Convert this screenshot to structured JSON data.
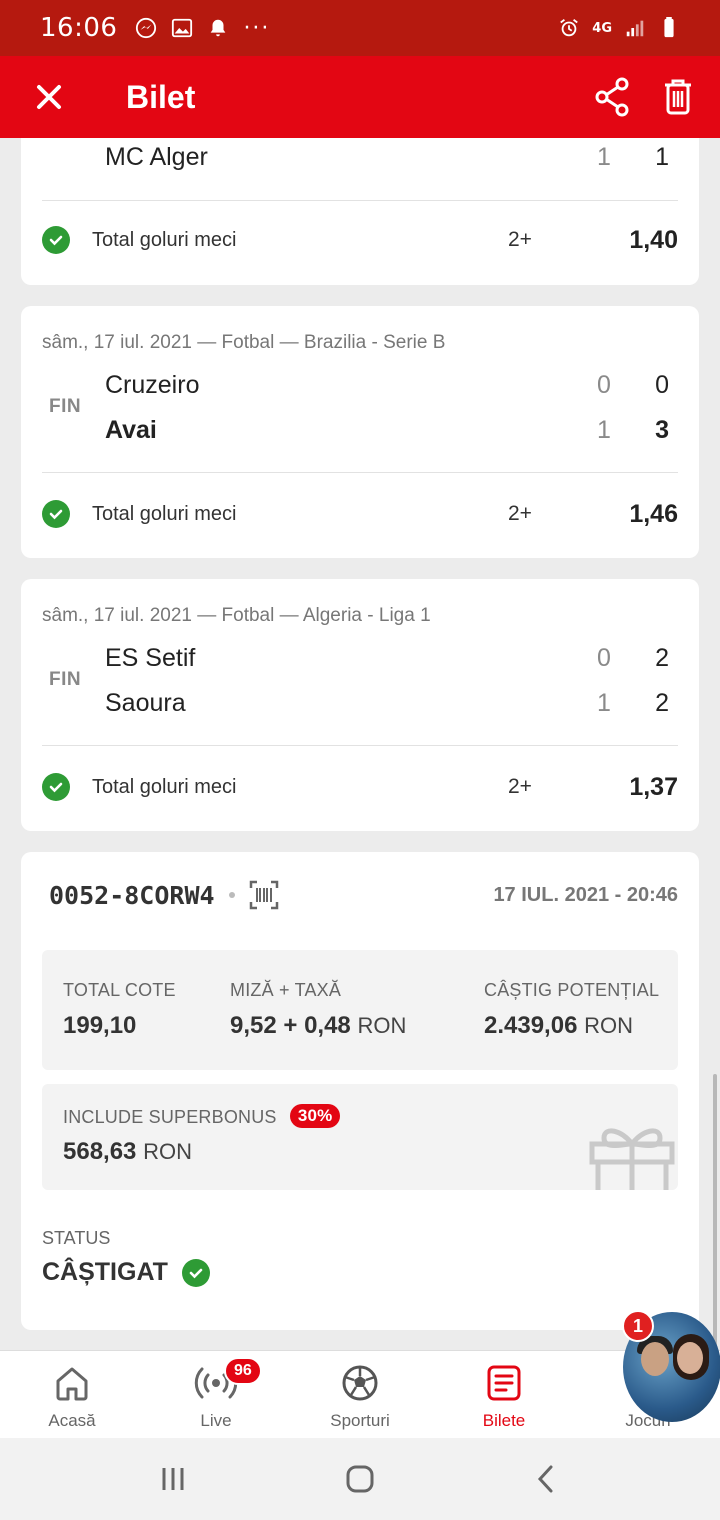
{
  "status_bar": {
    "time": "16:06",
    "network": "4G"
  },
  "app_bar": {
    "title": "Bilet"
  },
  "matches": [
    {
      "meta": "",
      "state": "",
      "teams": [
        {
          "name": "MC Alger",
          "ht": "1",
          "ft": "1",
          "winner": false
        }
      ],
      "market": "Total goluri meci",
      "selection": "2+",
      "odd": "1,40",
      "result": "won"
    },
    {
      "meta": "sâm., 17 iul. 2021 — Fotbal — Brazilia - Serie B",
      "state": "FIN",
      "teams": [
        {
          "name": "Cruzeiro",
          "ht": "0",
          "ft": "0",
          "winner": false
        },
        {
          "name": "Avai",
          "ht": "1",
          "ft": "3",
          "winner": true
        }
      ],
      "market": "Total goluri meci",
      "selection": "2+",
      "odd": "1,46",
      "result": "won"
    },
    {
      "meta": "sâm., 17 iul. 2021 — Fotbal — Algeria - Liga 1",
      "state": "FIN",
      "teams": [
        {
          "name": "ES Setif",
          "ht": "0",
          "ft": "2",
          "winner": false
        },
        {
          "name": "Saoura",
          "ht": "1",
          "ft": "2",
          "winner": false
        }
      ],
      "market": "Total goluri meci",
      "selection": "2+",
      "odd": "1,37",
      "result": "won"
    }
  ],
  "summary": {
    "ticket_code": "0052-8CORW4",
    "date": "17 IUL. 2021 - 20:46",
    "total_odds_label": "TOTAL COTE",
    "total_odds_value": "199,10",
    "stake_label": "MIZĂ + TAXĂ",
    "stake_value": "9,52 + 0,48",
    "potential_label": "CÂȘTIG POTENȚIAL",
    "potential_value": "2.439,06",
    "currency": "RON",
    "bonus_label": "INCLUDE SUPERBONUS",
    "bonus_percent": "30%",
    "bonus_value": "568,63",
    "status_label": "STATUS",
    "status_value": "CÂȘTIGAT"
  },
  "bottom_nav": [
    {
      "label": "Acasă",
      "icon": "home-icon",
      "active": false
    },
    {
      "label": "Live",
      "icon": "live-broadcast-icon",
      "badge": "96",
      "active": false
    },
    {
      "label": "Sporturi",
      "icon": "soccer-ball-icon",
      "active": false
    },
    {
      "label": "Bilete",
      "icon": "ticket-list-icon",
      "active": true
    },
    {
      "label": "Jocuri",
      "icon": "games-icon",
      "active": false
    }
  ],
  "chat_head": {
    "count": "1"
  },
  "colors": {
    "brand_red": "#e30613",
    "status_bar": "#b5190f",
    "win_green": "#2e9b35"
  }
}
